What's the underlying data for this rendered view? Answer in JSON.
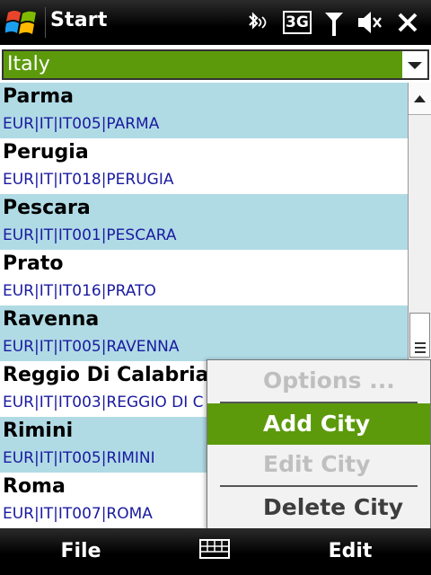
{
  "titlebar": {
    "title": "Start",
    "icons": [
      "windows-start-icon",
      "bluetooth-icon",
      "3g-data-icon",
      "signal-strength-icon",
      "speaker-muted-icon",
      "close-icon"
    ],
    "data_badge": "3G"
  },
  "country_selector": {
    "selected": "Italy"
  },
  "cities": [
    {
      "name": "Parma",
      "code": "EUR|IT|IT005|PARMA"
    },
    {
      "name": "Perugia",
      "code": "EUR|IT|IT018|PERUGIA"
    },
    {
      "name": "Pescara",
      "code": "EUR|IT|IT001|PESCARA"
    },
    {
      "name": "Prato",
      "code": "EUR|IT|IT016|PRATO"
    },
    {
      "name": "Ravenna",
      "code": "EUR|IT|IT005|RAVENNA"
    },
    {
      "name": "Reggio Di Calabria",
      "code": "EUR|IT|IT003|REGGIO DI C"
    },
    {
      "name": "Rimini",
      "code": "EUR|IT|IT005|RIMINI"
    },
    {
      "name": "Roma",
      "code": "EUR|IT|IT007|ROMA"
    }
  ],
  "context_menu": {
    "items": [
      {
        "label": "Options ...",
        "state": "disabled"
      },
      {
        "label": "Add City",
        "state": "selected"
      },
      {
        "label": "Edit City",
        "state": "disabled"
      },
      {
        "label": "Delete City",
        "state": "normal"
      }
    ]
  },
  "softkeys": {
    "left": "File",
    "center_icon": "keyboard-icon",
    "right": "Edit"
  },
  "colors": {
    "accent_green": "#5c9a0c",
    "row_alt_blue": "#b0dbe5",
    "code_text": "#1a1aa0"
  }
}
